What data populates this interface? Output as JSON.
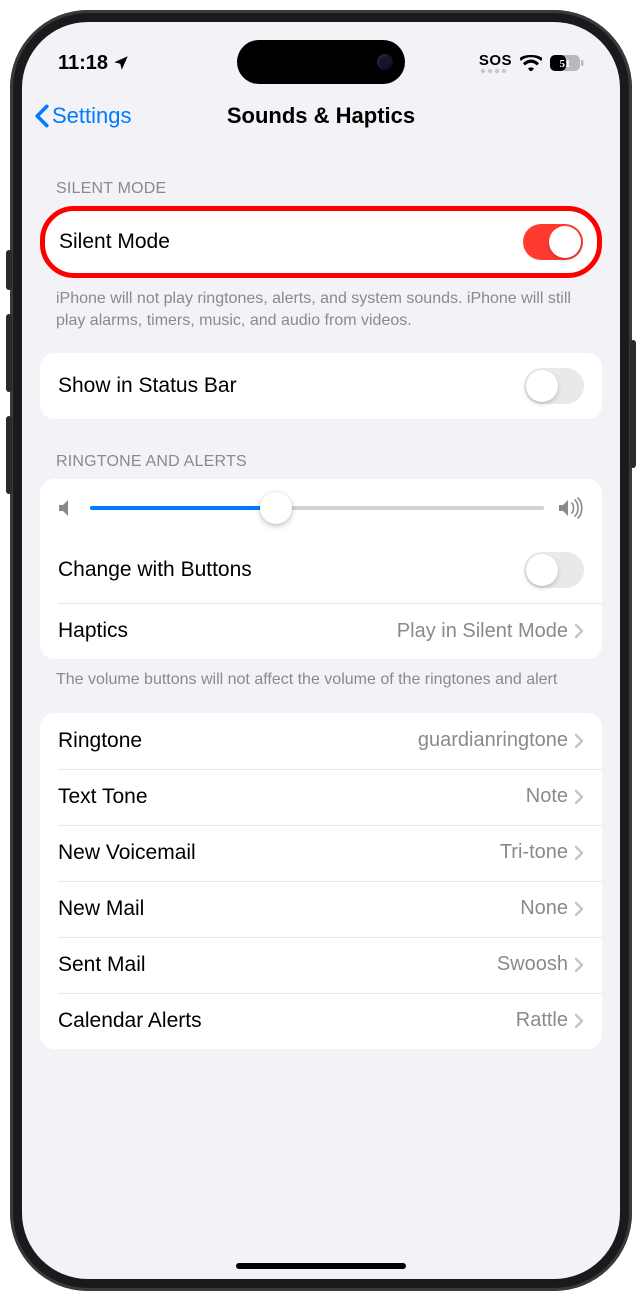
{
  "status": {
    "time": "11:18",
    "sos": "SOS",
    "battery_text": "51"
  },
  "nav": {
    "back_label": "Settings",
    "title": "Sounds & Haptics"
  },
  "silent_mode": {
    "header": "Silent Mode",
    "row_label": "Silent Mode",
    "toggle_on": true,
    "footer": "iPhone will not play ringtones, alerts, and system sounds. iPhone will still play alarms, timers, music, and audio from videos."
  },
  "status_bar_row": {
    "label": "Show in Status Bar",
    "toggle_on": false
  },
  "ringtone_alerts": {
    "header": "Ringtone and Alerts",
    "slider_percent": 41,
    "change_buttons_label": "Change with Buttons",
    "change_buttons_on": false,
    "haptics_label": "Haptics",
    "haptics_value": "Play in Silent Mode",
    "footer": "The volume buttons will not affect the volume of the ringtones and alert"
  },
  "sounds": [
    {
      "label": "Ringtone",
      "value": "guardianringtone"
    },
    {
      "label": "Text Tone",
      "value": "Note"
    },
    {
      "label": "New Voicemail",
      "value": "Tri-tone"
    },
    {
      "label": "New Mail",
      "value": "None"
    },
    {
      "label": "Sent Mail",
      "value": "Swoosh"
    },
    {
      "label": "Calendar Alerts",
      "value": "Rattle"
    }
  ]
}
